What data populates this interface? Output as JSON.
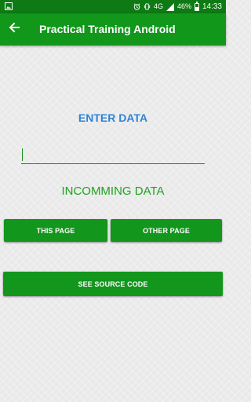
{
  "status_bar": {
    "battery_percent": "46%",
    "time": "14:33",
    "network_label": "4G",
    "icons": [
      "image-notification-icon",
      "alarm-icon",
      "vibrate-icon",
      "signal-icon",
      "battery-icon"
    ]
  },
  "app_bar": {
    "title": "Practical Training Android",
    "back_icon": "arrow-left-icon"
  },
  "main": {
    "enter_label": "ENTER DATA",
    "input_value": "",
    "incoming_label": "INCOMMING DATA",
    "this_page_button": "THIS PAGE",
    "other_page_button": "OTHER PAGE",
    "source_button": "SEE SOURCE CODE"
  },
  "colors": {
    "status_bar": "#0e7a14",
    "app_bar": "#11971a",
    "button": "#12961c",
    "enter_label": "#2f83d9",
    "incoming_label": "#1ea31f",
    "background": "#ececec"
  }
}
